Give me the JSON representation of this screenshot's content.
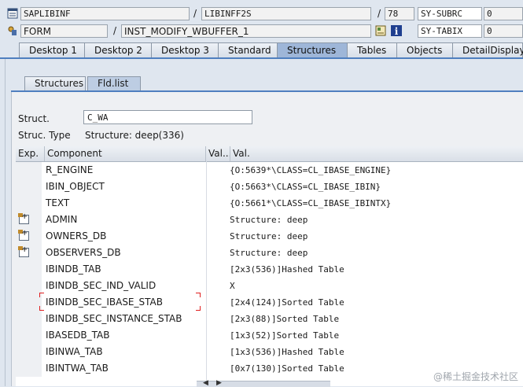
{
  "header": {
    "row1": {
      "program": "SAPLIBINF",
      "include": "LIBINFF2S",
      "line": "78",
      "sysvar": "SY-SUBRC",
      "sysval": "0"
    },
    "row2": {
      "event_type": "FORM",
      "event_name": "INST_MODIFY_WBUFFER_1",
      "sysvar": "SY-TABIX",
      "sysval": "0"
    },
    "icons": [
      "program-icon",
      "form-icon",
      "source-icon",
      "info-icon"
    ]
  },
  "tabs": [
    {
      "label": "Desktop 1"
    },
    {
      "label": "Desktop 2"
    },
    {
      "label": "Desktop 3"
    },
    {
      "label": "Standard"
    },
    {
      "label": "Structures",
      "active": true
    },
    {
      "label": "Tables"
    },
    {
      "label": "Objects"
    },
    {
      "label": "DetailDisplay"
    }
  ],
  "subtabs": [
    {
      "label": "Structures"
    },
    {
      "label": "Fld.list",
      "active": true
    }
  ],
  "struct": {
    "label": "Struct.",
    "value": "C_WA",
    "type_label": "Struc. Type",
    "type_value": "Structure: deep(336)"
  },
  "table": {
    "headers": {
      "exp": "Exp.",
      "component": "Component",
      "valshort": "Val...",
      "val": "Val."
    },
    "rows": [
      {
        "expandable": false,
        "component": "R_ENGINE",
        "value": "{O:5639*\\CLASS=CL_IBASE_ENGINE}"
      },
      {
        "expandable": false,
        "component": "IBIN_OBJECT",
        "value": "{O:5663*\\CLASS=CL_IBASE_IBIN}"
      },
      {
        "expandable": false,
        "component": "TEXT",
        "value": "{O:5661*\\CLASS=CL_IBASE_IBINTX}"
      },
      {
        "expandable": true,
        "component": "ADMIN",
        "value": "Structure: deep"
      },
      {
        "expandable": true,
        "component": "OWNERS_DB",
        "value": "Structure: deep"
      },
      {
        "expandable": true,
        "component": "OBSERVERS_DB",
        "value": "Structure: deep"
      },
      {
        "expandable": false,
        "component": "IBINDB_TAB",
        "value": "[2x3(536)]Hashed Table"
      },
      {
        "expandable": false,
        "component": "IBINDB_SEC_IND_VALID",
        "value": "X"
      },
      {
        "expandable": false,
        "component": "IBINDB_SEC_IBASE_STAB",
        "value": "[2x4(124)]Sorted Table"
      },
      {
        "expandable": false,
        "component": "IBINDB_SEC_INSTANCE_STAB",
        "value": "[2x3(88)]Sorted Table"
      },
      {
        "expandable": false,
        "component": "IBASEDB_TAB",
        "value": "[1x3(52)]Sorted Table"
      },
      {
        "expandable": false,
        "component": "IBINWA_TAB",
        "value": "[1x3(536)]Hashed Table"
      },
      {
        "expandable": false,
        "component": "IBINTWA_TAB",
        "value": "[0x7(130)]Sorted Table"
      }
    ]
  },
  "watermark": "@稀土掘金技术社区",
  "colors": {
    "active_tab": "#9eb6d8",
    "accent_bar": "#4f7fbf",
    "selection_marker": "#e02020"
  }
}
